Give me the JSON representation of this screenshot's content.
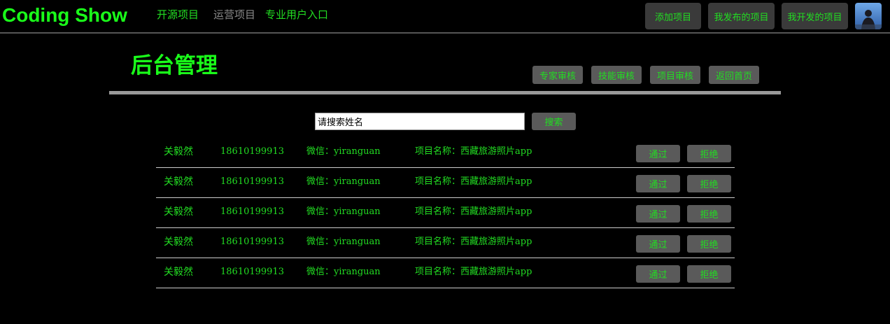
{
  "brand": "Coding Show",
  "nav": {
    "open_source": "开源项目",
    "operations": "运营项目",
    "pro_entry": "专业用户入口"
  },
  "top_buttons": {
    "add_project": "添加项目",
    "my_published": "我发布的项目",
    "my_developed": "我开发的项目"
  },
  "page_title": "后台管理",
  "admin_tabs": [
    "专家审核",
    "技能审核",
    "项目审核",
    "返回首页"
  ],
  "search": {
    "value": "请搜索姓名",
    "button": "搜索"
  },
  "rows": [
    {
      "name": "关毅然",
      "phone": "18610199913",
      "wechat_label": "微信：",
      "wechat": "yiranguan",
      "project_label": "项目名称：",
      "project": "西藏旅游照片app",
      "pass": "通过",
      "reject": "拒绝"
    },
    {
      "name": "关毅然",
      "phone": "18610199913",
      "wechat_label": "微信：",
      "wechat": "yiranguan",
      "project_label": "项目名称：",
      "project": "西藏旅游照片app",
      "pass": "通过",
      "reject": "拒绝"
    },
    {
      "name": "关毅然",
      "phone": "18610199913",
      "wechat_label": "微信：",
      "wechat": "yiranguan",
      "project_label": "项目名称：",
      "project": "西藏旅游照片app",
      "pass": "通过",
      "reject": "拒绝"
    },
    {
      "name": "关毅然",
      "phone": "18610199913",
      "wechat_label": "微信：",
      "wechat": "yiranguan",
      "project_label": "项目名称：",
      "project": "西藏旅游照片app",
      "pass": "通过",
      "reject": "拒绝"
    },
    {
      "name": "关毅然",
      "phone": "18610199913",
      "wechat_label": "微信：",
      "wechat": "yiranguan",
      "project_label": "项目名称：",
      "project": "西藏旅游照片app",
      "pass": "通过",
      "reject": "拒绝"
    }
  ],
  "colors": {
    "accent": "#22dd22",
    "brand": "#1aff1a",
    "button_bg": "#5a5a5a",
    "muted_link": "#8a8a8a"
  }
}
